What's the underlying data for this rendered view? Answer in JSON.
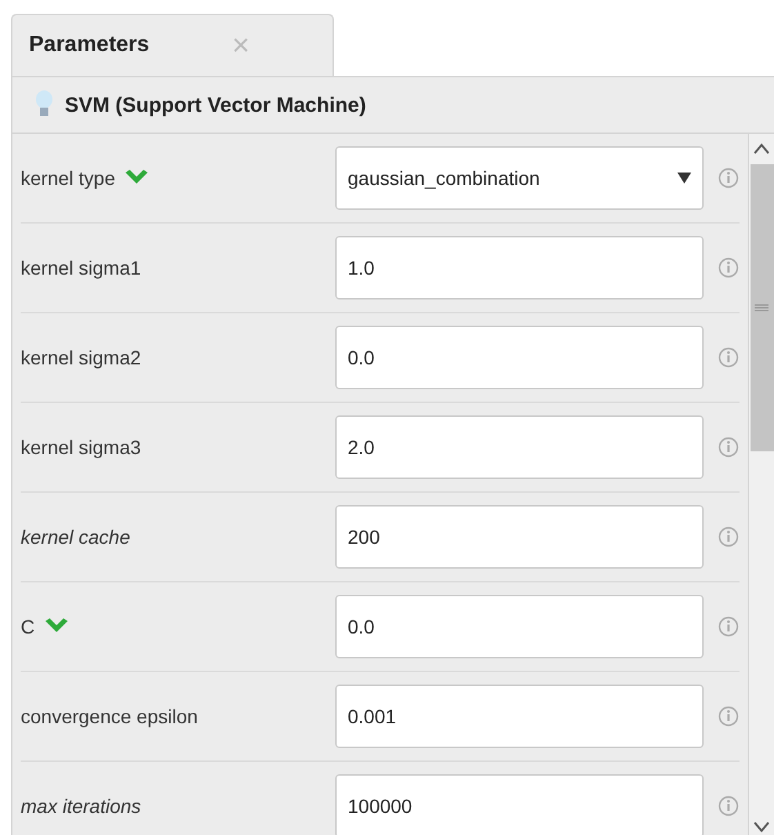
{
  "tab": {
    "label": "Parameters",
    "close": "×"
  },
  "operator": {
    "title": "SVM (Support Vector Machine)"
  },
  "parameters": [
    {
      "label": "kernel type",
      "kind": "select",
      "value": "gaussian_combination",
      "expert": false,
      "flagged": true
    },
    {
      "label": "kernel sigma1",
      "kind": "text",
      "value": "1.0",
      "expert": false,
      "flagged": false
    },
    {
      "label": "kernel sigma2",
      "kind": "text",
      "value": "0.0",
      "expert": false,
      "flagged": false
    },
    {
      "label": "kernel sigma3",
      "kind": "text",
      "value": "2.0",
      "expert": false,
      "flagged": false
    },
    {
      "label": "kernel cache",
      "kind": "text",
      "value": "200",
      "expert": true,
      "flagged": false
    },
    {
      "label": "C",
      "kind": "text",
      "value": "0.0",
      "expert": false,
      "flagged": true
    },
    {
      "label": "convergence epsilon",
      "kind": "text",
      "value": "0.001",
      "expert": false,
      "flagged": false
    },
    {
      "label": "max iterations",
      "kind": "text",
      "value": "100000",
      "expert": true,
      "flagged": false
    }
  ]
}
